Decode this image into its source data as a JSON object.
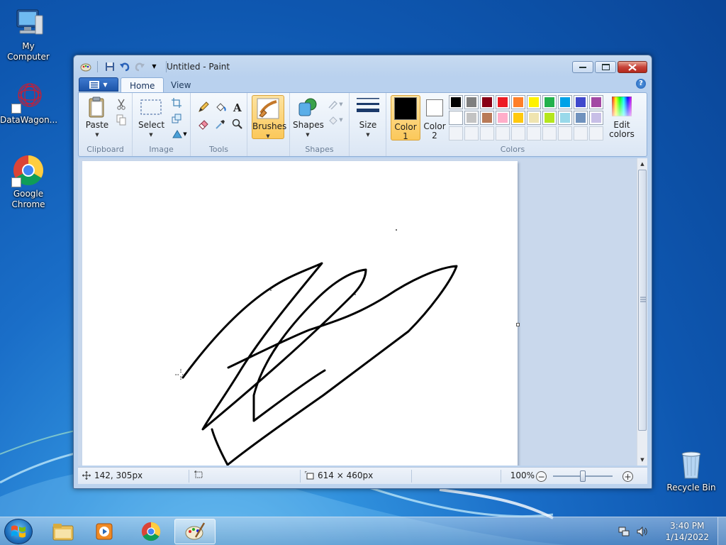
{
  "desktop": {
    "icons": [
      {
        "label": "My Computer"
      },
      {
        "label": "DataWagon..."
      },
      {
        "label": "Google Chrome"
      },
      {
        "label": "Recycle Bin"
      }
    ]
  },
  "window": {
    "title": "Untitled - Paint"
  },
  "ribbon": {
    "tabs": [
      "Home",
      "View"
    ],
    "groups": {
      "clipboard": {
        "label": "Clipboard",
        "paste": "Paste"
      },
      "image": {
        "label": "Image",
        "select": "Select"
      },
      "tools": {
        "label": "Tools"
      },
      "brushes": {
        "label": "Brushes"
      },
      "shapes": {
        "label": "Shapes",
        "shapes": "Shapes"
      },
      "size": {
        "label": "Size"
      },
      "colors": {
        "label": "Colors",
        "color1_line1": "Color",
        "color1_line2": "1",
        "color2_line1": "Color",
        "color2_line2": "2",
        "edit_line1": "Edit",
        "edit_line2": "colors",
        "color1_value": "#000000",
        "color2_value": "#ffffff",
        "palette": [
          "#000000",
          "#7f7f7f",
          "#880015",
          "#ed1c24",
          "#ff7f27",
          "#fff200",
          "#22b14c",
          "#00a2e8",
          "#3f48cc",
          "#a349a4",
          "#ffffff",
          "#c3c3c3",
          "#b97a57",
          "#ffaec9",
          "#ffc90e",
          "#efe4b0",
          "#b5e61d",
          "#99d9ea",
          "#7092be",
          "#c8bfe7",
          "",
          "",
          "",
          "",
          "",
          "",
          "",
          "",
          "",
          ""
        ]
      }
    }
  },
  "status": {
    "cursor_pos": "142, 305px",
    "selection_size": "",
    "image_size": "614 × 460px",
    "zoom": "100%",
    "zoom_percent": 100
  },
  "taskbar": {
    "time": "3:40 PM",
    "date": "1/14/2022"
  }
}
